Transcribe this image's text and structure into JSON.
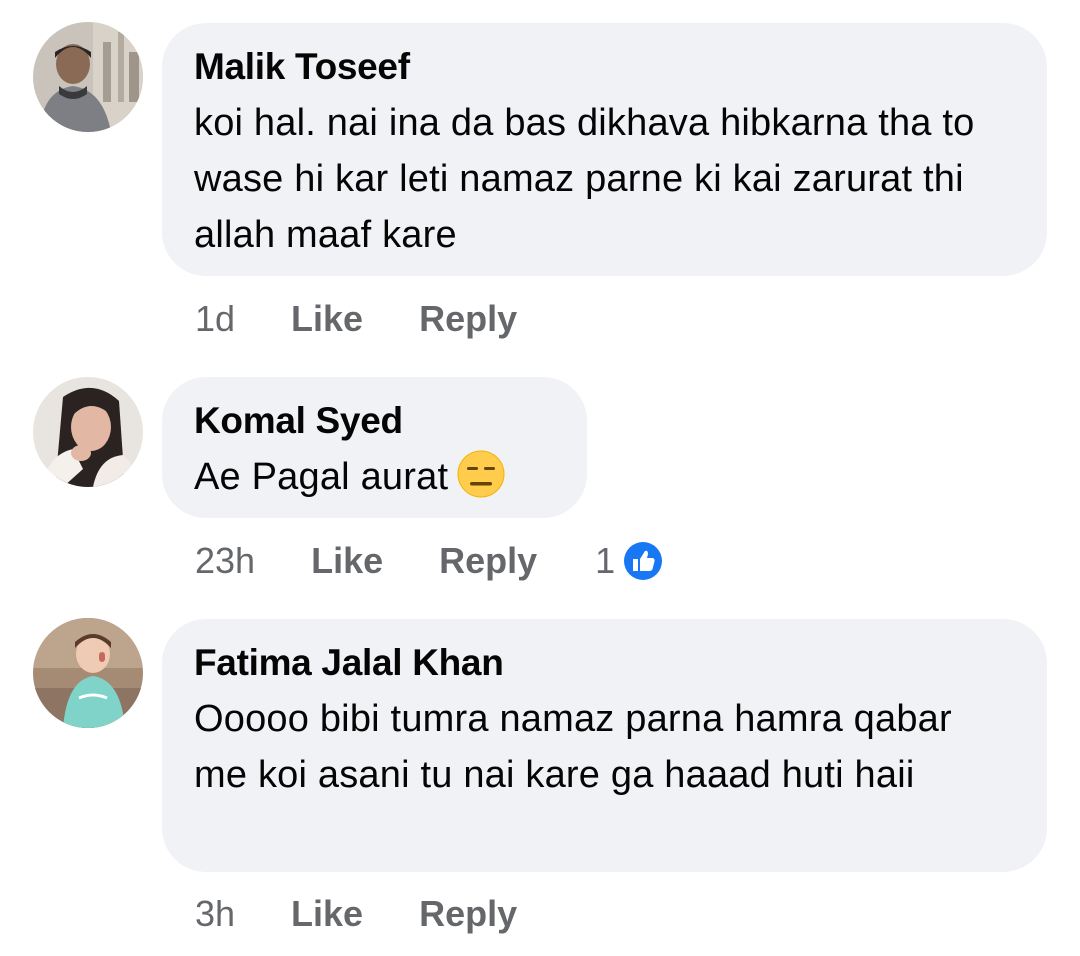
{
  "comments": [
    {
      "author": "Malik Toseef",
      "text": "koi hal. nai ina da bas dikhava hibkarna tha to wase hi kar leti namaz parne ki kai zarurat thi allah maaf kare",
      "time": "1d",
      "like_label": "Like",
      "reply_label": "Reply"
    },
    {
      "author": "Komal Syed",
      "text": "Ae Pagal aurat",
      "emoji": "expressionless-face-icon",
      "time": "23h",
      "like_label": "Like",
      "reply_label": "Reply",
      "reaction_count": "1",
      "reaction_type": "like-reaction-icon"
    },
    {
      "author": "Fatima Jalal Khan",
      "text": "Ooooo bibi tumra namaz parna hamra qabar me koi asani tu nai kare ga haaad huti haii",
      "time": "3h",
      "like_label": "Like",
      "reply_label": "Reply"
    }
  ],
  "colors": {
    "bubble_bg": "#f0f2f5",
    "meta_text": "#65676b",
    "like_blue": "#1877f2"
  }
}
